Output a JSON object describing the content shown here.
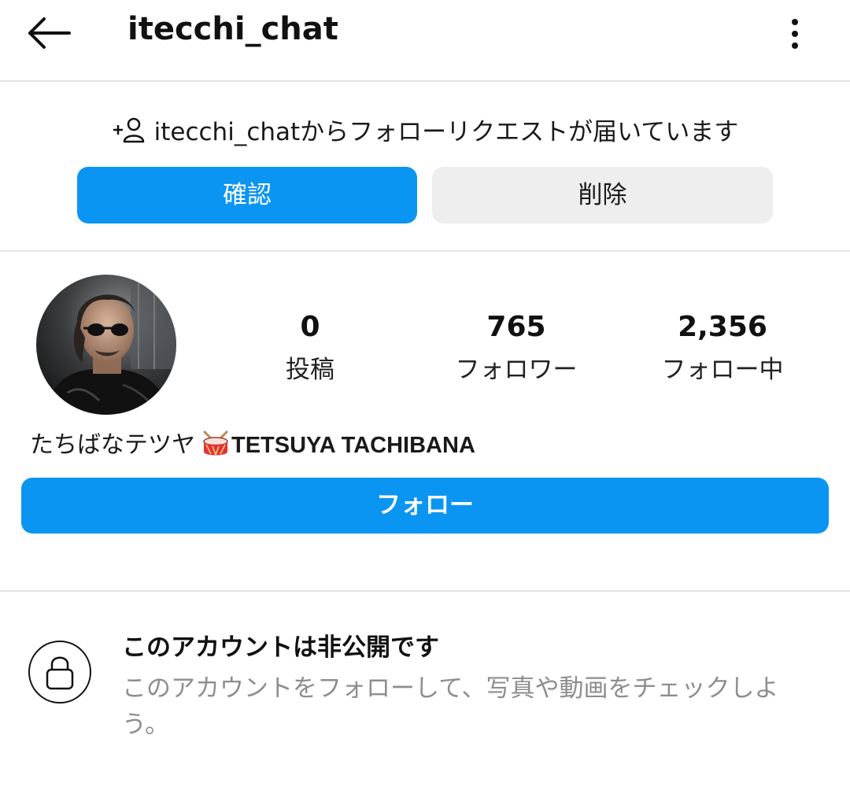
{
  "header": {
    "username": "itecchi_chat",
    "back_icon": "arrow-left-icon",
    "more_icon": "vertical-dots-icon"
  },
  "follow_request": {
    "icon": "add-user-icon",
    "username": "itecchi_chat",
    "text_suffix": "からフォローリクエストが届いています",
    "confirm_label": "確認",
    "delete_label": "削除"
  },
  "profile": {
    "stats": [
      {
        "value": "0",
        "label": "投稿"
      },
      {
        "value": "765",
        "label": "フォロワー"
      },
      {
        "value": "2,356",
        "label": "フォロー中"
      }
    ],
    "name_jp": "たちばなテツヤ",
    "name_emoji": "drum-icon",
    "name_latin": "TETSUYA TACHIBANA",
    "follow_label": "フォロー"
  },
  "private": {
    "icon": "lock-icon",
    "title": "このアカウントは非公開です",
    "description": "このアカウントをフォローして、写真や動画をチェックしよう。"
  },
  "colors": {
    "accent": "#0a95f2",
    "secondary_button": "#eeeeee",
    "muted_text": "#8e8e8e",
    "divider": "#e4e4e4"
  }
}
